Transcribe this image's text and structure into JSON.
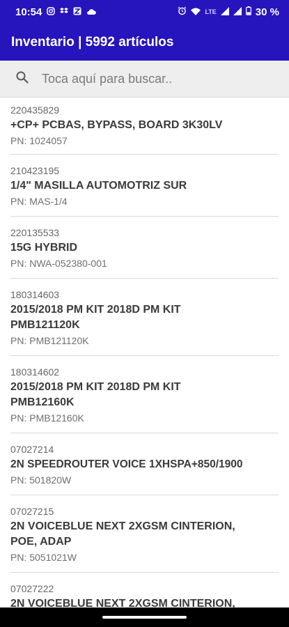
{
  "status_bar": {
    "time": "10:54",
    "left_icons": [
      "instagram-icon",
      "dropbox-icon",
      "app-icon",
      "cloud-icon"
    ],
    "right_icons": [
      "alarm-icon",
      "wifi-icon",
      "lte-signal-icon",
      "signal-icon",
      "battery-icon"
    ],
    "lte_label": "LTE",
    "battery": "30 %"
  },
  "app_bar": {
    "title": "Inventario | 5992 artículos"
  },
  "search": {
    "placeholder": "Toca aquí para buscar.."
  },
  "items": [
    {
      "code": "220435829",
      "name": "+CP+ PCBAS, BYPASS, BOARD 3K30LV",
      "pn": "PN: 1024057"
    },
    {
      "code": "210423195",
      "name": "1/4\" MASILLA AUTOMOTRIZ SUR",
      "pn": "PN: MAS-1/4"
    },
    {
      "code": "220135533",
      "name": "15G HYBRID",
      "pn": "PN: NWA-052380-001"
    },
    {
      "code": "180314603",
      "name": "2015/2018 PM KIT 2018D PM KIT PMB121120K",
      "pn": "PN: PMB121120K"
    },
    {
      "code": "180314602",
      "name": "2015/2018 PM KIT 2018D PM KIT PMB12160K",
      "pn": "PN: PMB12160K"
    },
    {
      "code": "07027214",
      "name": "2N SPEEDROUTER VOICE 1XHSPA+850/1900",
      "pn": "PN: 501820W"
    },
    {
      "code": "07027215",
      "name": "2N VOICEBLUE NEXT 2XGSM CINTERION, POE, ADAP",
      "pn": "PN: 5051021W"
    },
    {
      "code": "07027222",
      "name": "2N VOICEBLUE NEXT 2XGSM CINTERION,",
      "pn": ""
    }
  ],
  "colors": {
    "primary": "#2614bd",
    "search_bg": "#eeeeee",
    "divider": "#d9d9d9"
  }
}
